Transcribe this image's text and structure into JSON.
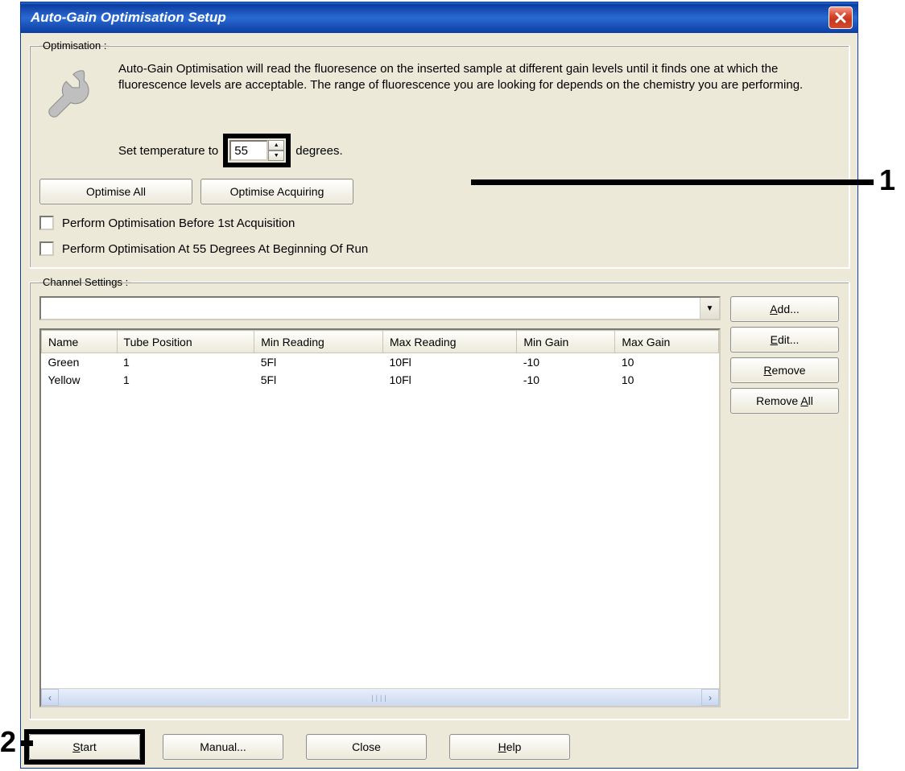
{
  "window": {
    "title": "Auto-Gain Optimisation Setup"
  },
  "optimisation": {
    "legend": "Optimisation :",
    "description": "Auto-Gain Optimisation will read the fluoresence on the inserted sample at different gain levels until it finds one at which the fluorescence levels are acceptable. The range of fluorescence you are looking for depends on the chemistry you are performing.",
    "temp_prefix": "Set temperature to",
    "temp_value": "55",
    "temp_suffix": "degrees.",
    "optimise_all": "Optimise All",
    "optimise_acquiring": "Optimise Acquiring",
    "check1": "Perform Optimisation Before 1st Acquisition",
    "check2": "Perform Optimisation At 55 Degrees At Beginning Of Run"
  },
  "channel": {
    "legend": "Channel Settings :",
    "dropdown_value": "",
    "headers": {
      "name": "Name",
      "tube": "Tube Position",
      "minr": "Min Reading",
      "maxr": "Max Reading",
      "ming": "Min Gain",
      "maxg": "Max Gain"
    },
    "rows": [
      {
        "name": "Green",
        "tube": "1",
        "minr": "5Fl",
        "maxr": "10Fl",
        "ming": "-10",
        "maxg": "10"
      },
      {
        "name": "Yellow",
        "tube": "1",
        "minr": "5Fl",
        "maxr": "10Fl",
        "ming": "-10",
        "maxg": "10"
      }
    ],
    "buttons": {
      "add": "dd...",
      "edit": "dit...",
      "remove": "emove",
      "remove_all": "Remove ",
      "remove_all_u": "ll",
      "remove_all_pre": "A"
    }
  },
  "bottom": {
    "start": "tart",
    "manual": "Manual...",
    "close": "Close",
    "help": "elp"
  },
  "callouts": {
    "one": "1",
    "two": "2"
  }
}
